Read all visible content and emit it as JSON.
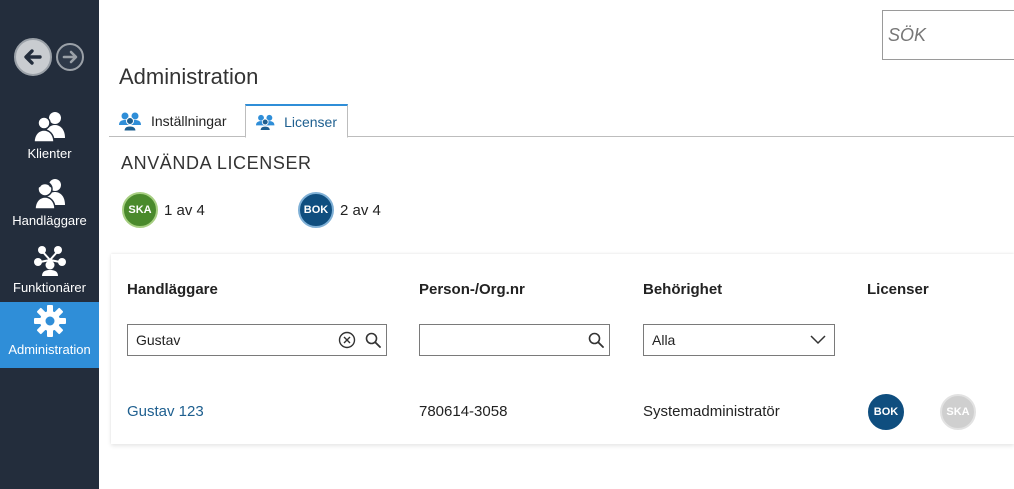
{
  "search": {
    "placeholder": "SÖK"
  },
  "sidebar": {
    "items": [
      {
        "label": "Klienter",
        "icon": "users-icon"
      },
      {
        "label": "Handläggare",
        "icon": "caseworker-icon"
      },
      {
        "label": "Funktionärer",
        "icon": "network-icon"
      },
      {
        "label": "Administration",
        "icon": "gear-icon",
        "active": true
      }
    ]
  },
  "page": {
    "title": "Administration"
  },
  "tabs": [
    {
      "label": "Inställningar",
      "icon": "users-icon",
      "active": false
    },
    {
      "label": "Licenser",
      "icon": "users-icon",
      "active": true
    }
  ],
  "licenses": {
    "title": "ANVÄNDA LICENSER",
    "items": [
      {
        "code": "SKA",
        "usage": "1 av 4",
        "color": "#4a8a2c"
      },
      {
        "code": "BOK",
        "usage": "2 av 4",
        "color": "#0f4e7f"
      }
    ]
  },
  "table": {
    "columns": [
      "Handläggare",
      "Person-/Org.nr",
      "Behörighet",
      "Licenser"
    ],
    "filters": {
      "handlaggare": "Gustav",
      "orgnr": "",
      "behorighet": "Alla"
    },
    "rows": [
      {
        "name": "Gustav 123",
        "orgnr": "780614-3058",
        "role": "Systemadministratör",
        "licenses": [
          {
            "code": "BOK",
            "active": true
          },
          {
            "code": "SKA",
            "active": false
          }
        ]
      }
    ]
  },
  "colors": {
    "sidebar": "#232d3c",
    "active": "#2f8ed8",
    "link": "#1e5f8f",
    "ska": "#4a8a2c",
    "bok": "#0f4e7f"
  }
}
